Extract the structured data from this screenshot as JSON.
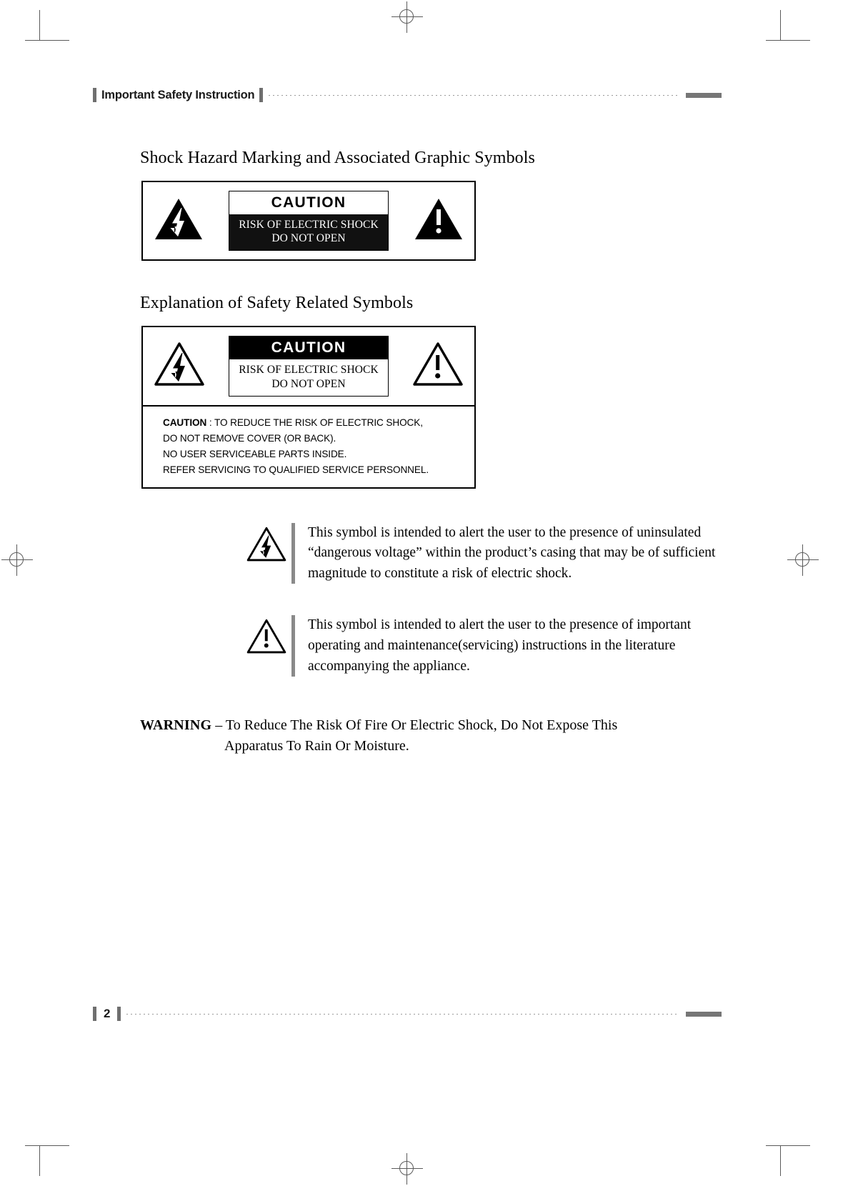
{
  "document": {
    "running_head": "Important Safety Instruction",
    "page_number": "2"
  },
  "sections": [
    {
      "heading": "Shock Hazard Marking and Associated Graphic Symbols",
      "style": "filled"
    },
    {
      "heading": "Explanation of Safety Related Symbols",
      "style": "outline"
    }
  ],
  "caution_panel": {
    "word": "CAUTION",
    "line1": "RISK OF ELECTRIC SHOCK",
    "line2": "DO NOT OPEN",
    "left_symbol": "lightning-bolt-triangle-icon",
    "right_symbol": "exclamation-triangle-icon"
  },
  "caution_note": {
    "lead": "CAUTION",
    "line1": " : TO REDUCE THE RISK OF ELECTRIC SHOCK,",
    "line2": "DO NOT REMOVE COVER (OR BACK).",
    "line3": "NO USER SERVICEABLE PARTS INSIDE.",
    "line4": "REFER SERVICING TO QUALIFIED SERVICE PERSONNEL."
  },
  "explanations": [
    {
      "symbol": "lightning-bolt-triangle-icon",
      "text": "This symbol is intended to alert the user to the presence of uninsulated “dangerous voltage” within the product’s casing that may be of sufficient magnitude to constitute a risk of electric shock."
    },
    {
      "symbol": "exclamation-triangle-icon",
      "text": "This symbol is intended to alert the user to the presence of important operating and maintenance(servicing) instructions in the literature accompanying the appliance."
    }
  ],
  "warning": {
    "label": "WARNING",
    "line1": " – To Reduce The Risk Of Fire Or Electric Shock, Do Not Expose This",
    "line2": "Apparatus To Rain Or Moisture."
  },
  "colors": {
    "text": "#000000",
    "rule": "#9a9a9a",
    "bar": "#8a8a8a",
    "endbar": "#767676"
  }
}
